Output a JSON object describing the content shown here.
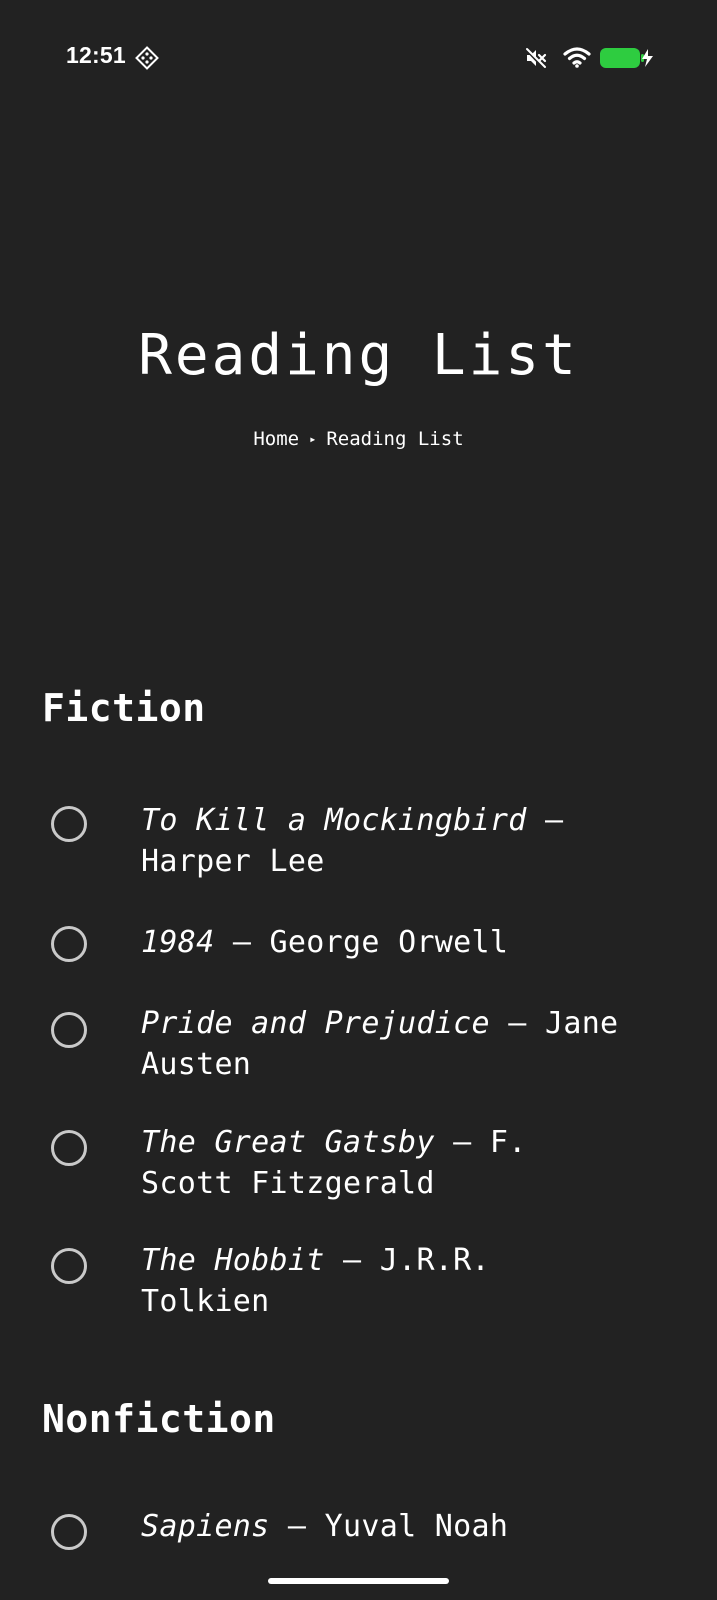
{
  "status_bar": {
    "time": "12:51",
    "icons": [
      "app-badge-icon",
      "mute-icon",
      "wifi-icon",
      "battery-charging-icon"
    ],
    "battery_color": "#2ecc40"
  },
  "header": {
    "title": "Reading List",
    "breadcrumb": {
      "home": "Home",
      "separator": "▸",
      "current": "Reading List"
    }
  },
  "sections": {
    "fiction": {
      "heading": "Fiction",
      "items": [
        {
          "title": "To Kill a Mockingbird",
          "dash": " — ",
          "author": "Harper Lee",
          "checked": false
        },
        {
          "title": "1984",
          "dash": " — ",
          "author": "George Orwell",
          "checked": false
        },
        {
          "title": "Pride and Prejudice",
          "dash": " — ",
          "author": "Jane Austen",
          "checked": false
        },
        {
          "title": "The Great Gatsby",
          "dash": " — ",
          "author": "F. Scott Fitzgerald",
          "checked": false
        },
        {
          "title": "The Hobbit",
          "dash": " — ",
          "author": "J.R.R. Tolkien",
          "checked": false
        }
      ]
    },
    "nonfiction": {
      "heading": "Nonfiction",
      "items": [
        {
          "title": "Sapiens",
          "dash": " — ",
          "author": "Yuval Noah",
          "checked": false
        }
      ]
    }
  },
  "colors": {
    "background": "#222222",
    "text": "#ffffff",
    "checkbox_border": "#c9c9c9"
  }
}
